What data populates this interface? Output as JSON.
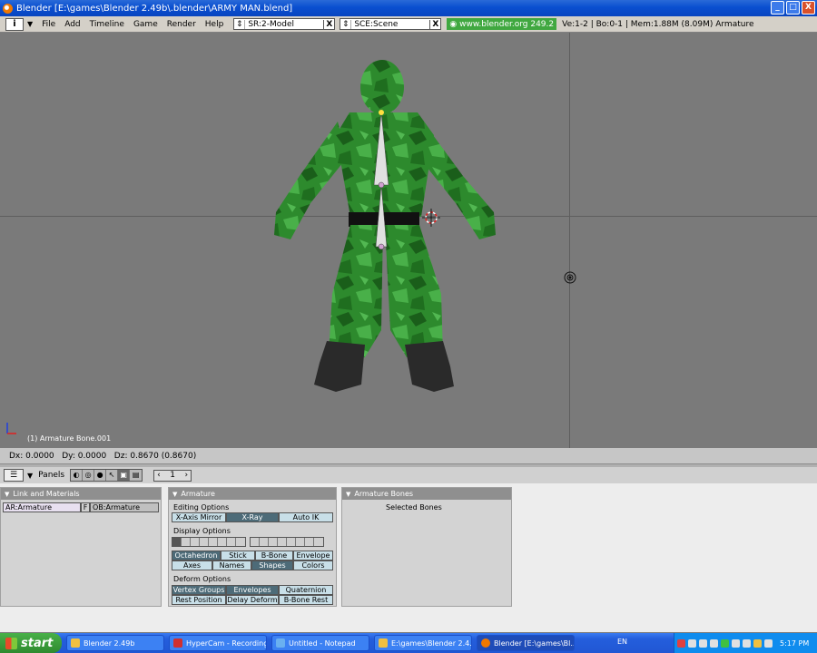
{
  "window": {
    "title": "Blender [E:\\games\\Blender 2.49b\\.blender\\ARMY MAN.blend]",
    "min": "_",
    "max": "□",
    "close": "X"
  },
  "menubar": {
    "info_button": "i",
    "items": [
      "File",
      "Add",
      "Timeline",
      "Game",
      "Render",
      "Help"
    ],
    "screen_field": "SR:2-Model",
    "scene_field": "SCE:Scene",
    "website": "www.blender.org 249.2",
    "stats": "Ve:1-2 | Bo:0-1 | Mem:1.88M (8.09M) Armature"
  },
  "viewport": {
    "object_label": "(1) Armature Bone.001"
  },
  "transform_header": {
    "text": "Dx: 0.0000   Dy: 0.0000   Dz: 0.8670 (0.8670)"
  },
  "buttons_header": {
    "panels_label": "Panels",
    "frame_value": "1",
    "frame_left": "‹",
    "frame_right": "›"
  },
  "panels": {
    "link_materials": {
      "title": "Link and Materials",
      "armature_field": "AR:Armature",
      "f_label": "F",
      "object_field": "OB:Armature"
    },
    "armature": {
      "title": "Armature",
      "editing_label": "Editing Options",
      "editing_buttons": [
        "X-Axis Mirror",
        "X-Ray",
        "Auto IK"
      ],
      "display_label": "Display Options",
      "draw_buttons_row1": [
        "Octahedron",
        "Stick",
        "B-Bone",
        "Envelope"
      ],
      "draw_buttons_row2": [
        "Axes",
        "Names",
        "Shapes",
        "Colors"
      ],
      "deform_label": "Deform Options",
      "deform_row1": [
        "Vertex Groups",
        "Envelopes",
        "Quaternion"
      ],
      "deform_row2": [
        "Rest Position",
        "Delay Deform",
        "B-Bone Rest"
      ]
    },
    "armature_bones": {
      "title": "Armature Bones",
      "selected_label": "Selected Bones"
    }
  },
  "taskbar": {
    "start": "start",
    "items": [
      {
        "label": "Blender 2.49b"
      },
      {
        "label": "HyperCam - Recording"
      },
      {
        "label": "Untitled - Notepad"
      },
      {
        "label": "E:\\games\\Blender 2.4..."
      },
      {
        "label": "Blender [E:\\games\\Bl..."
      }
    ],
    "language": "EN",
    "clock": "5:17 PM"
  }
}
